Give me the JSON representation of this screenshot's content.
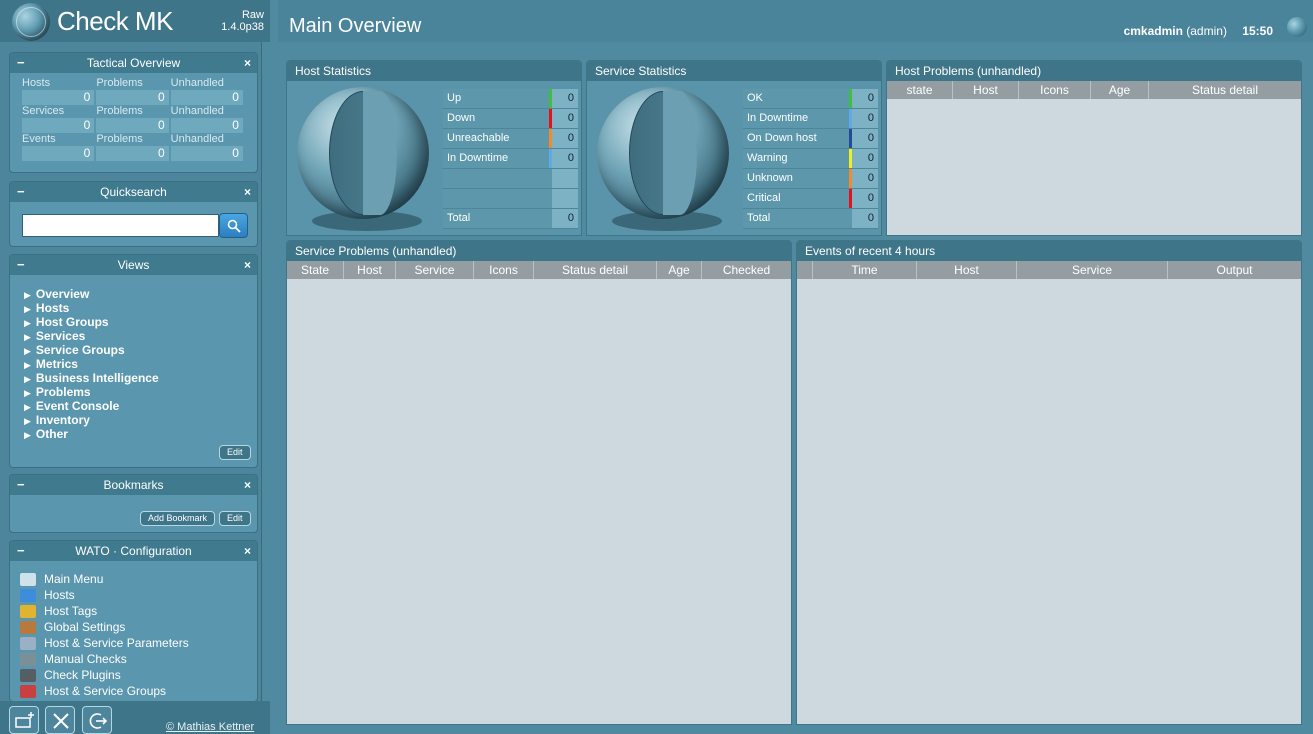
{
  "app": {
    "brand": "Check MK",
    "edition_line1": "Raw",
    "edition_line2": "1.4.0p38"
  },
  "tactical": {
    "title": "Tactical Overview",
    "rows": [
      {
        "labels": [
          "Hosts",
          "Problems",
          "Unhandled"
        ],
        "values": [
          "0",
          "0",
          "0"
        ]
      },
      {
        "labels": [
          "Services",
          "Problems",
          "Unhandled"
        ],
        "values": [
          "0",
          "0",
          "0"
        ]
      },
      {
        "labels": [
          "Events",
          "Problems",
          "Unhandled"
        ],
        "values": [
          "0",
          "0",
          "0"
        ]
      }
    ]
  },
  "quicksearch": {
    "title": "Quicksearch",
    "value": ""
  },
  "views": {
    "title": "Views",
    "items": [
      "Overview",
      "Hosts",
      "Host Groups",
      "Services",
      "Service Groups",
      "Metrics",
      "Business Intelligence",
      "Problems",
      "Event Console",
      "Inventory",
      "Other"
    ],
    "edit_label": "Edit"
  },
  "bookmarks": {
    "title": "Bookmarks",
    "add_label": "Add Bookmark",
    "edit_label": "Edit"
  },
  "wato": {
    "title": "WATO · Configuration",
    "items": [
      "Main Menu",
      "Hosts",
      "Host Tags",
      "Global Settings",
      "Host & Service Parameters",
      "Manual Checks",
      "Check Plugins",
      "Host & Service Groups"
    ]
  },
  "snapin_controls": {
    "minimize": "−",
    "close": "×"
  },
  "footer": {
    "copyright": "© Mathias Kettner"
  },
  "header": {
    "title": "Main Overview",
    "user": "cmkadmin",
    "role": "(admin)",
    "time": "15:50"
  },
  "host_stats": {
    "title": "Host Statistics",
    "rows": [
      {
        "label": "Up",
        "value": "0",
        "color": "#3fbf3f"
      },
      {
        "label": "Down",
        "value": "0",
        "color": "#e8101b"
      },
      {
        "label": "Unreachable",
        "value": "0",
        "color": "#f28b2b"
      },
      {
        "label": "In Downtime",
        "value": "0",
        "color": "#5ea9e8"
      },
      {
        "label": "",
        "value": "",
        "color": ""
      },
      {
        "label": "",
        "value": "",
        "color": ""
      },
      {
        "label": "Total",
        "value": "0",
        "color": ""
      }
    ]
  },
  "service_stats": {
    "title": "Service Statistics",
    "rows": [
      {
        "label": "OK",
        "value": "0",
        "color": "#3fbf3f"
      },
      {
        "label": "In Downtime",
        "value": "0",
        "color": "#5ea9e8"
      },
      {
        "label": "On Down host",
        "value": "0",
        "color": "#214d98"
      },
      {
        "label": "Warning",
        "value": "0",
        "color": "#f0f020"
      },
      {
        "label": "Unknown",
        "value": "0",
        "color": "#f28b2b"
      },
      {
        "label": "Critical",
        "value": "0",
        "color": "#e8101b"
      },
      {
        "label": "Total",
        "value": "0",
        "color": ""
      }
    ]
  },
  "host_problems": {
    "title": "Host Problems (unhandled)",
    "columns": [
      "state",
      "Host",
      "Icons",
      "Age",
      "Status detail"
    ]
  },
  "service_problems": {
    "title": "Service Problems (unhandled)",
    "columns": [
      "State",
      "Host",
      "Service",
      "Icons",
      "Status detail",
      "Age",
      "Checked"
    ]
  },
  "events": {
    "title": "Events of recent 4 hours",
    "columns": [
      "",
      "Time",
      "Host",
      "Service",
      "Output"
    ]
  }
}
